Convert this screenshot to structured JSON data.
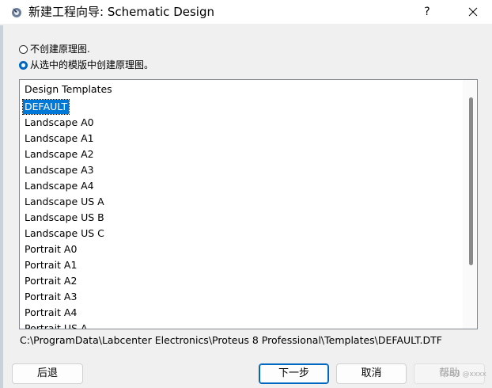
{
  "window": {
    "title": "新建工程向导: Schematic Design",
    "help_label": "?"
  },
  "options": {
    "radio1_label": "不创建原理图.",
    "radio2_label": "从选中的模版中创建原理图。",
    "selected": "radio2"
  },
  "list": {
    "header": "Design Templates",
    "selected_item": "DEFAULT",
    "items": [
      "DEFAULT",
      "Landscape A0",
      "Landscape A1",
      "Landscape A2",
      "Landscape A3",
      "Landscape A4",
      "Landscape US A",
      "Landscape US B",
      "Landscape US C",
      "Portrait A0",
      "Portrait A1",
      "Portrait A2",
      "Portrait A3",
      "Portrait A4",
      "Portrait US A"
    ]
  },
  "path": "C:\\ProgramData\\Labcenter Electronics\\Proteus 8 Professional\\Templates\\DEFAULT.DTF",
  "buttons": {
    "back": "后退",
    "next": "下一步",
    "cancel": "取消",
    "help": "帮助"
  },
  "watermark": "CSDN @xxxx"
}
